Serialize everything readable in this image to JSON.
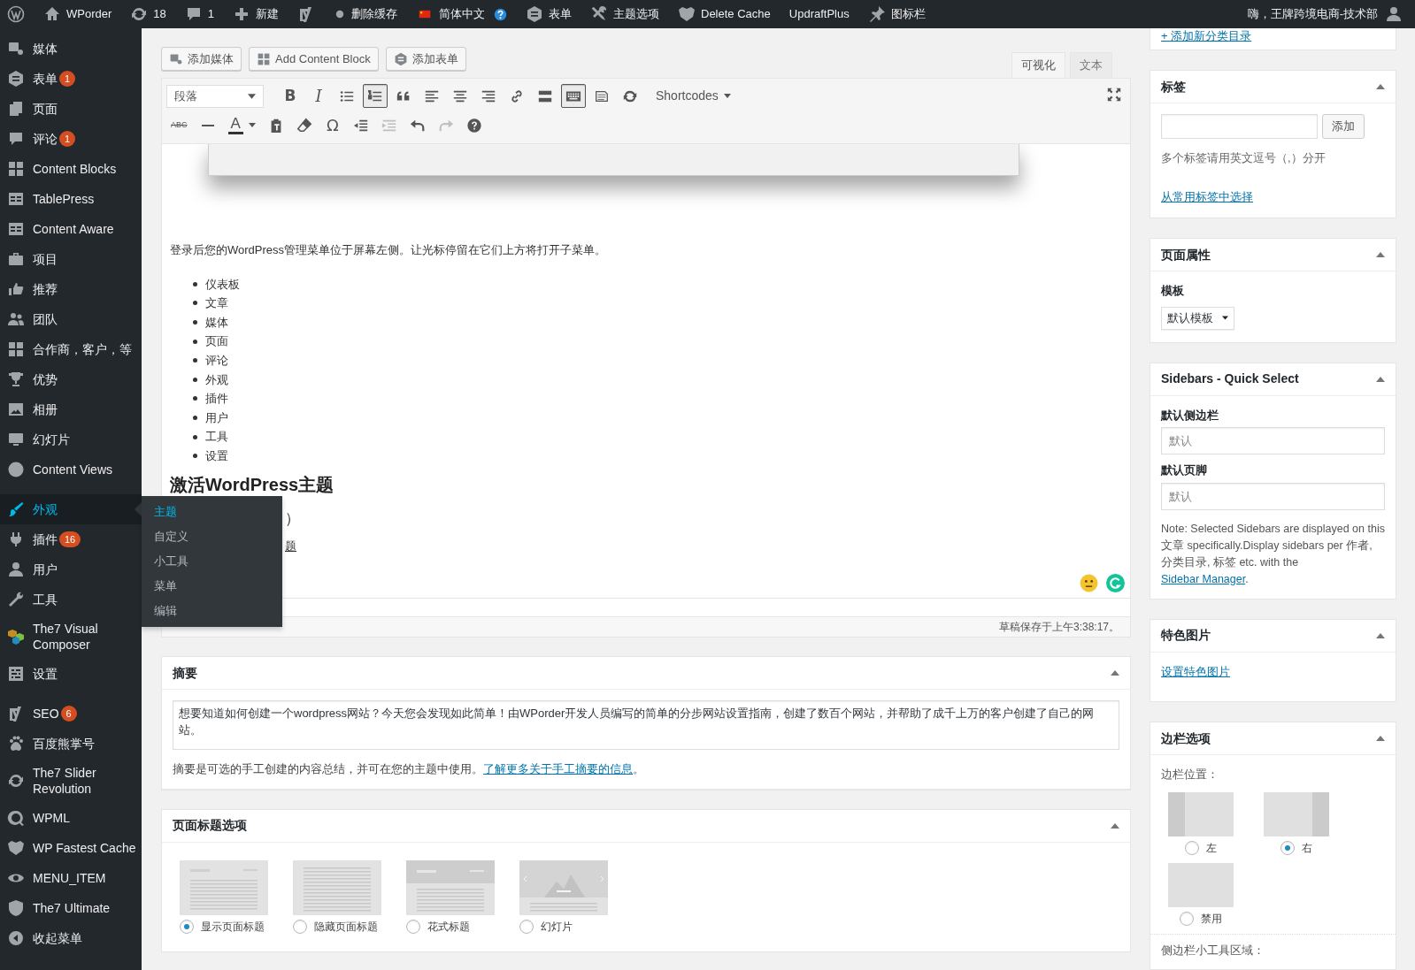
{
  "admin_bar": {
    "items": [
      "WPorder",
      "18",
      "1",
      "新建",
      "删除缓存",
      "简体中文",
      "表单",
      "主题选项",
      "Delete Cache",
      "UpdraftPlus",
      "图标栏"
    ],
    "account": "嗨，王牌跨境电商-技术部"
  },
  "sidebar": {
    "groups": [
      [
        {
          "label": "媒体",
          "selected": false
        },
        {
          "label": "表单",
          "badge": "1",
          "selected": false
        },
        {
          "label": "页面",
          "selected": false
        },
        {
          "label": "评论",
          "badge": "1",
          "selected": false
        },
        {
          "label": "Content Blocks",
          "selected": false
        },
        {
          "label": "TablePress",
          "selected": false
        },
        {
          "label": "Content Aware",
          "selected": false
        },
        {
          "label": "项目",
          "selected": false
        },
        {
          "label": "推荐",
          "selected": false
        },
        {
          "label": "团队",
          "selected": false
        },
        {
          "label": "合作商，客户，等",
          "selected": false
        },
        {
          "label": "优势",
          "selected": false
        },
        {
          "label": "相册",
          "selected": false
        },
        {
          "label": "幻灯片",
          "selected": false
        },
        {
          "label": "Content Views",
          "selected": false
        }
      ],
      [
        {
          "label": "外观",
          "selected": true,
          "submenu": [
            {
              "label": "主题",
              "selected": true
            },
            {
              "label": "自定义",
              "selected": false
            },
            {
              "label": "小工具",
              "selected": false
            },
            {
              "label": "菜单",
              "selected": false
            },
            {
              "label": "编辑",
              "selected": false
            }
          ]
        },
        {
          "label": "插件",
          "badge": "16",
          "selected": false
        },
        {
          "label": "用户",
          "selected": false
        },
        {
          "label": "工具",
          "selected": false
        },
        {
          "label": "The7 Visual Composer",
          "selected": false
        },
        {
          "label": "设置",
          "selected": false
        }
      ],
      [
        {
          "label": "SEO",
          "badge": "6",
          "selected": false
        },
        {
          "label": "百度熊掌号",
          "selected": false
        },
        {
          "label": "The7 Slider Revolution",
          "selected": false
        },
        {
          "label": "WPML",
          "selected": false
        },
        {
          "label": "WP Fastest Cache",
          "selected": false
        },
        {
          "label": "MENU_ITEM",
          "selected": false
        },
        {
          "label": "The7 Ultimate",
          "selected": false
        },
        {
          "label": "收起菜单",
          "selected": false
        }
      ]
    ]
  },
  "editor": {
    "media_buttons": [
      "添加媒体",
      "Add Content Block",
      "添加表单"
    ],
    "tabs": [
      {
        "label": "可视化",
        "selected": true
      },
      {
        "label": "文本",
        "selected": false
      }
    ],
    "format": "段落",
    "toolbar_rows": [
      [
        {
          "kind": "bold",
          "label": "B",
          "active": false,
          "disabled": false
        },
        {
          "kind": "italic",
          "label": "I",
          "active": false,
          "disabled": false
        },
        {
          "kind": "bullets",
          "active": false,
          "disabled": false
        },
        {
          "kind": "numbers",
          "active": true,
          "disabled": false
        },
        {
          "kind": "quote",
          "active": false,
          "disabled": false
        },
        {
          "kind": "align-left",
          "active": false,
          "disabled": false
        },
        {
          "kind": "align-center",
          "active": false,
          "disabled": false
        },
        {
          "kind": "align-right",
          "active": false,
          "disabled": false
        },
        {
          "kind": "link",
          "active": false,
          "disabled": false
        },
        {
          "kind": "more",
          "active": false,
          "disabled": false
        },
        {
          "kind": "toggle",
          "active": true,
          "disabled": false
        },
        {
          "kind": "document",
          "active": false,
          "disabled": false
        },
        {
          "kind": "refresh",
          "active": false,
          "disabled": false
        },
        {
          "kind": "menu",
          "label": "Shortcodes",
          "active": false,
          "disabled": false
        }
      ],
      [
        {
          "kind": "strike",
          "label": "ABC",
          "active": false,
          "disabled": false
        },
        {
          "kind": "hr",
          "active": false,
          "disabled": false
        },
        {
          "kind": "color",
          "label": "A",
          "active": false,
          "disabled": false
        },
        {
          "kind": "paste",
          "active": false,
          "disabled": false
        },
        {
          "kind": "eraser",
          "active": false,
          "disabled": false
        },
        {
          "kind": "symbol",
          "label": "Ω",
          "active": false,
          "disabled": false
        },
        {
          "kind": "outdent",
          "active": false,
          "disabled": false
        },
        {
          "kind": "indent",
          "active": false,
          "disabled": true
        },
        {
          "kind": "undo",
          "active": false,
          "disabled": false
        },
        {
          "kind": "redo",
          "active": false,
          "disabled": true
        },
        {
          "kind": "help",
          "active": false,
          "disabled": false
        }
      ]
    ],
    "content": {
      "intro": "登录后您的WordPress管理菜单位于屏幕左侧。让光标停留在它们上方将打开子菜单。",
      "list": [
        "仪表板",
        "文章",
        "媒体",
        "页面",
        "评论",
        "外观",
        "插件",
        "用户",
        "工具",
        "设置"
      ],
      "heading": "激活WordPress主题",
      "fragment_1": "）",
      "fragment_2": "题"
    },
    "status": "草稿保存于上午3:38:17。"
  },
  "excerpt": {
    "title": "摘要",
    "text": "想要知道如何创建一个wordpress网站？今天您会发现如此简单！由WPorder开发人员编写的简单的分步网站设置指南，创建了数百个网站，并帮助了成千上万的客户创建了自己的网站。",
    "help": "摘要是可选的手工创建的内容总结，并可在您的主题中使用。",
    "help_link": "了解更多关于手工摘要的信息",
    "help_end": "。"
  },
  "title_options": {
    "title": "页面标题选项",
    "options": [
      {
        "kind": "standard",
        "label": "显示页面标题",
        "selected": true
      },
      {
        "kind": "hidden",
        "label": "隐藏页面标题",
        "selected": false
      },
      {
        "kind": "fancy",
        "label": "花式标题",
        "selected": false
      },
      {
        "kind": "slideshow",
        "label": "幻灯片",
        "selected": false
      }
    ]
  },
  "right": {
    "category_link": "+ 添加新分类目录",
    "tags": {
      "title": "标签",
      "button": "添加",
      "hint": "多个标签请用英文逗号（,）分开",
      "link": "从常用标签中选择"
    },
    "attributes": {
      "title": "页面属性",
      "label": "模板",
      "value": "默认模板"
    },
    "sidebars": {
      "title": "Sidebars - Quick Select",
      "fields": [
        {
          "label": "默认侧边栏",
          "placeholder": "默认"
        },
        {
          "label": "默认页脚",
          "placeholder": "默认"
        }
      ],
      "note": "Note: Selected Sidebars are displayed on this 文章 specifically.Display sidebars per 作者, 分类目录, 标签 etc. with the ",
      "note_link": "Sidebar Manager",
      "note_end": "."
    },
    "featured": {
      "title": "特色图片",
      "link": "设置特色图片"
    },
    "sidebar_options": {
      "title": "边栏选项",
      "label": "边栏位置：",
      "positions": [
        {
          "kind": "left",
          "label": "左",
          "selected": false
        },
        {
          "kind": "right",
          "label": "右",
          "selected": true
        },
        {
          "kind": "none",
          "label": "禁用",
          "selected": false
        }
      ],
      "widget_label": "侧边栏小工具区域："
    }
  }
}
